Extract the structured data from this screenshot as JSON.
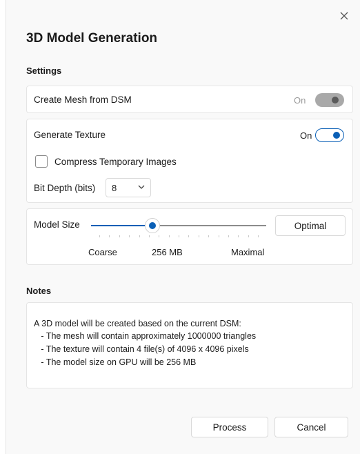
{
  "dialog": {
    "title": "3D Model Generation",
    "close_icon": "close-icon"
  },
  "settings": {
    "label": "Settings",
    "mesh": {
      "label": "Create Mesh from DSM",
      "toggle_text": "On",
      "enabled": true,
      "disabled": true
    },
    "texture": {
      "label": "Generate Texture",
      "toggle_text": "On",
      "enabled": true,
      "compress_label": "Compress Temporary Images",
      "compress_checked": false,
      "bit_depth_label": "Bit Depth (bits)",
      "bit_depth_value": "8"
    },
    "model_size": {
      "label": "Model Size",
      "min_label": "Coarse",
      "current_label": "256 MB",
      "max_label": "Maximal",
      "optimal_button": "Optimal",
      "slider_fraction": 0.35
    }
  },
  "notes": {
    "label": "Notes",
    "lines": [
      "A 3D model will be created based on the current DSM:",
      "   - The mesh will contain approximately 1000000 triangles",
      "   - The texture will contain 4 file(s) of 4096 x 4096 pixels",
      "   - The model size on GPU will be 256 MB"
    ]
  },
  "footer": {
    "process_button": "Process",
    "cancel_button": "Cancel"
  },
  "colors": {
    "accent": "#0a5fb6",
    "disabled_toggle": "#a9a9a9"
  }
}
